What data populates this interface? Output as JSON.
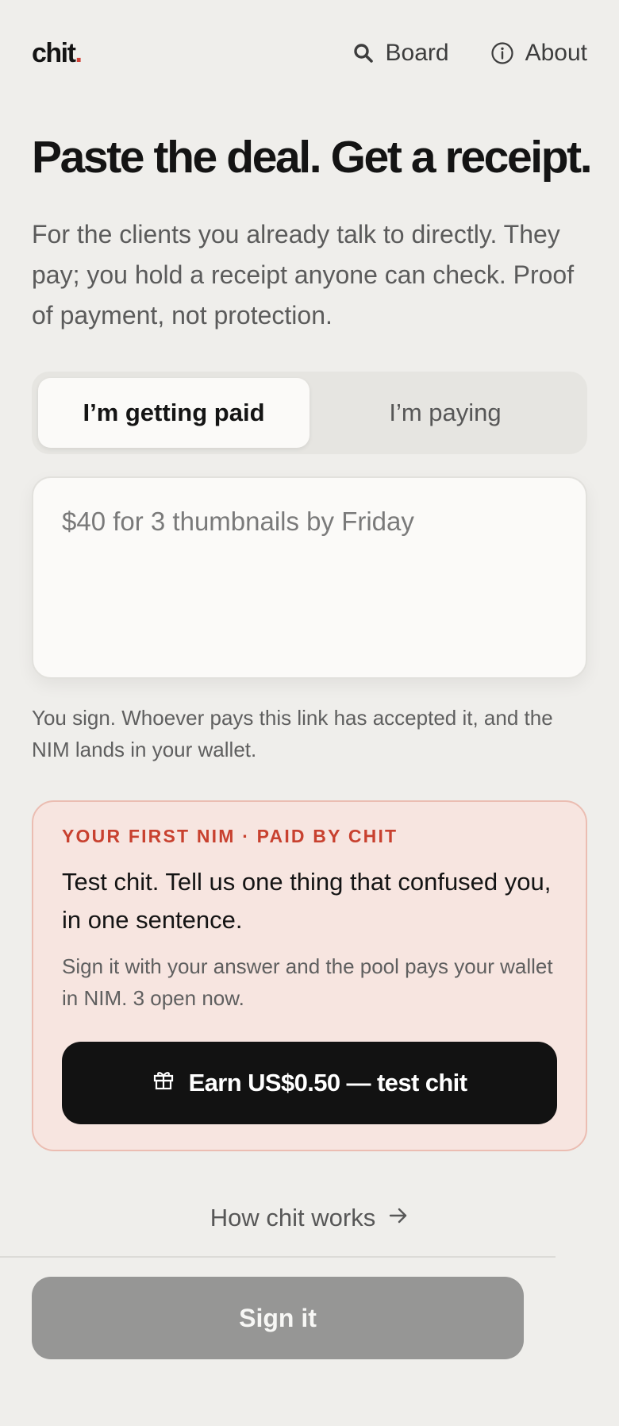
{
  "header": {
    "logo_text": "chit",
    "logo_dot": ".",
    "nav": [
      {
        "label": "Board",
        "icon": "search-icon"
      },
      {
        "label": "About",
        "icon": "info-icon"
      }
    ]
  },
  "hero": {
    "title": "Paste the deal. Get a receipt.",
    "subtitle": "For the clients you already talk to directly. They pay; you hold a receipt anyone can check. Proof of payment, not protection."
  },
  "toggle": {
    "options": [
      "I’m getting paid",
      "I’m paying"
    ],
    "selected": "I’m getting paid"
  },
  "deal_input": {
    "placeholder": "$40 for 3 thumbnails by Friday",
    "value": ""
  },
  "helper_text": "You sign. Whoever pays this link has accepted it, and the NIM lands in your wallet.",
  "promo": {
    "kicker": "YOUR FIRST NIM · PAID BY CHIT",
    "title": "Test chit. Tell us one thing that confused you, in one sentence.",
    "description": "Sign it with your answer and the pool pays your wallet in NIM. 3 open now.",
    "button_label": "Earn US$0.50 — test chit",
    "button_icon": "gift-icon"
  },
  "how_link": {
    "label": "How chit works",
    "icon": "arrow-right-icon"
  },
  "sign_button": {
    "label": "Sign it",
    "state": "disabled"
  },
  "colors": {
    "background": "#efeeeb",
    "accent": "#d0443a",
    "promo_bg": "#f7e5e0",
    "promo_border": "#ebbdb2",
    "promo_kicker": "#c8412f",
    "cta_dark": "#121212",
    "disabled_button": "#969695"
  }
}
